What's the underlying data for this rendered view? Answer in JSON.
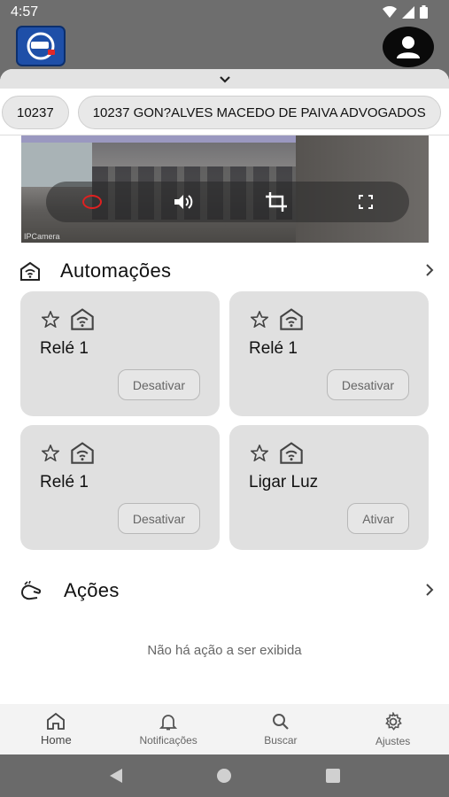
{
  "status_bar": {
    "time": "4:57"
  },
  "chips": [
    "10237",
    "10237 GON?ALVES MACEDO DE PAIVA ADVOGADOS"
  ],
  "camera": {
    "watermark": "IPCamera"
  },
  "automations": {
    "title": "Automações",
    "cards": [
      {
        "name": "Relé 1",
        "button": "Desativar"
      },
      {
        "name": "Relé 1",
        "button": "Desativar"
      },
      {
        "name": "Relé 1",
        "button": "Desativar"
      },
      {
        "name": "Ligar Luz",
        "button": "Ativar"
      }
    ]
  },
  "actions": {
    "title": "Ações",
    "empty_message": "Não há ação a ser exibida"
  },
  "bottom_nav": [
    {
      "label": "Home",
      "icon": "home-icon",
      "active": true
    },
    {
      "label": "Notificações",
      "icon": "bell-icon"
    },
    {
      "label": "Buscar",
      "icon": "search-icon"
    },
    {
      "label": "Ajustes",
      "icon": "gear-icon"
    }
  ]
}
